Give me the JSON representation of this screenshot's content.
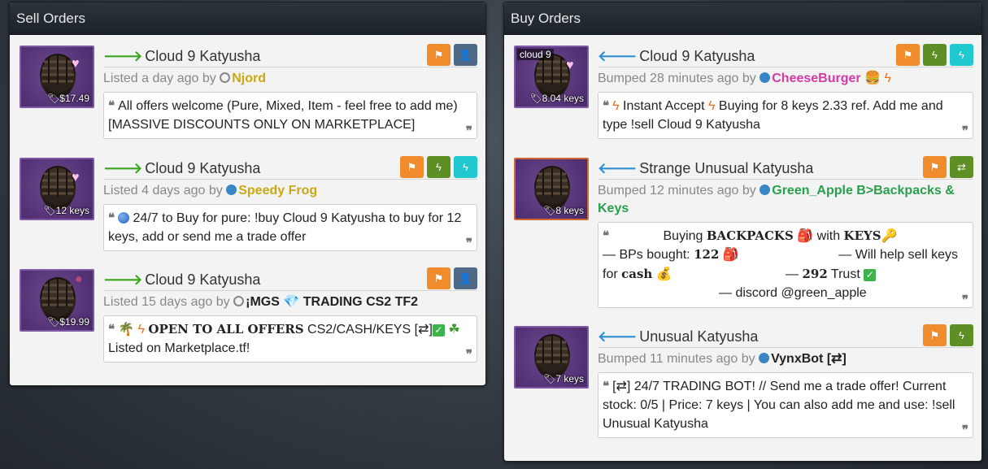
{
  "sell": {
    "heading": "Sell Orders",
    "listings": [
      {
        "title": "Cloud 9 Katyusha",
        "price": "$17.49",
        "meta_prefix": "Listed a day ago by",
        "user": "Njord",
        "desc": "All offers welcome (Pure, Mixed, Item - feel free to add me) [MASSIVE DISCOUNTS ONLY ON MARKETPLACE]",
        "buttons": [
          "flag-icon",
          "add-friend-icon"
        ]
      },
      {
        "title": "Cloud 9 Katyusha",
        "price": "12 keys",
        "meta_prefix": "Listed 4 days ago by",
        "user": "Speedy Frog",
        "desc": "24/7 to Buy for pure: !buy Cloud 9 Katyusha to buy for 12 keys, add or send me a trade offer",
        "buttons": [
          "flag-icon",
          "lightning-icon",
          "lightning-icon"
        ]
      },
      {
        "title": "Cloud 9 Katyusha",
        "price": "$19.99",
        "meta_prefix": "Listed 15 days ago by",
        "user": "¡MGS",
        "user_suffix": "TRADING CS2 TF2",
        "desc_bold": "OPEN TO ALL OFFERS",
        "desc_a": "CS2/CASH/KEYS [⇄]",
        "desc_b": "Listed on Marketplace.tf!",
        "buttons": [
          "flag-icon",
          "add-friend-icon"
        ]
      }
    ]
  },
  "buy": {
    "heading": "Buy Orders",
    "listings": [
      {
        "title": "Cloud 9 Katyusha",
        "craft_label": "cloud 9",
        "price": "8.04 keys",
        "meta_prefix": "Bumped 28 minutes ago by",
        "user": "CheeseBurger",
        "desc_a": "Instant Accept",
        "desc_b": "Buying for 8 keys 2.33 ref. Add me and type !sell Cloud 9 Katyusha",
        "buttons": [
          "flag-icon",
          "lightning-icon",
          "lightning-icon"
        ]
      },
      {
        "title": "Strange Unusual Katyusha",
        "price": "8 keys",
        "meta_prefix": "Bumped 12 minutes ago by",
        "user": "Green_Apple B>Backpacks & Keys",
        "desc_l1_a": "Buying",
        "desc_l1_b": "BACKPACKS",
        "desc_l1_c": "with",
        "desc_l1_d": "KEYS",
        "desc_l2_a": "— BPs bought:",
        "desc_l2_b": "122",
        "desc_l2_c": "— Will help sell keys",
        "desc_l3_a": "for",
        "desc_l3_b": "cash",
        "desc_l3_c": "—",
        "desc_l3_d": "292",
        "desc_l3_e": "Trust",
        "desc_l4": "— discord @green_apple",
        "buttons": [
          "flag-icon",
          "exchange-icon"
        ]
      },
      {
        "title": "Unusual Katyusha",
        "price": "7 keys",
        "meta_prefix": "Bumped 11 minutes ago by",
        "user": "VynxBot [⇄]",
        "desc": "[⇄] 24/7 TRADING BOT! // Send me a trade offer! Current stock: 0/5 | Price: 7 keys | You can also add me and use: !sell Unusual Katyusha",
        "buttons": [
          "flag-icon",
          "lightning-icon"
        ]
      }
    ]
  },
  "colors": {
    "accent_orange": "#f08c2c",
    "accent_green": "#5d8f25",
    "accent_cyan": "#1fc9cf",
    "accent_slate": "#4e6a86",
    "unusual_purple": "#553277"
  }
}
